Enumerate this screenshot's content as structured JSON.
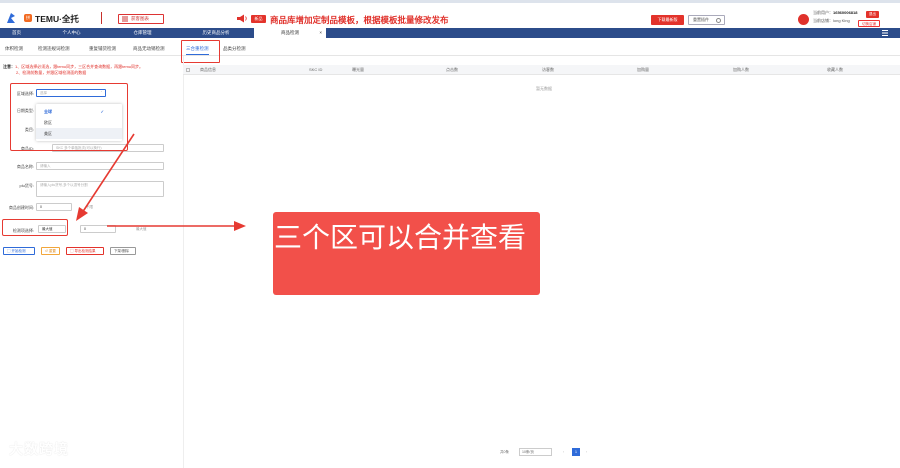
{
  "header": {
    "app_badge": "拼",
    "app_name": "TEMU·全托",
    "feature_btn": "获客图表",
    "new_tag": "新品",
    "announcement": "商品库增加定制品模板，根据模板批量修改发布",
    "install_btn": "下载最新版",
    "login_btn": "重置插件",
    "user_label": "当前用户：",
    "user_value": "16560006818",
    "store_label": "当前店铺：",
    "store_value": "long King",
    "logout_btn": "退出",
    "switch_btn": "切换店铺"
  },
  "page_tabs": [
    {
      "label": "首页"
    },
    {
      "label": "个人中心"
    },
    {
      "label": "仓库管理"
    },
    {
      "label": "历史商品分析"
    },
    {
      "label": "商品检测",
      "close": "×"
    }
  ],
  "sub_tabs": [
    "体积检测",
    "检测违规词检测",
    "重复铺货检测",
    "商品无动销检测",
    "三合重检测",
    "品类分检测"
  ],
  "notice": {
    "title": "注意：",
    "line1": "1、区域选择必须选，跟temu同步，三区合并查询数据，再跟temu同步。",
    "line2": "2、检测前数量，并跟区域检测面的数据"
  },
  "form": {
    "region_label": "区域选择:",
    "region_placeholder": "选择",
    "date_label": "日期类型:",
    "category_label": "类目:",
    "sku_label": "商品ID:",
    "sku_placeholder": "SKC    多个单独批次(可以换行)",
    "name_label": "商品名称:",
    "name_placeholder": "请输入",
    "plu_label": "plu货号:",
    "plu_placeholder": "请输入plu货号,多个以逗号分割",
    "time_label": "商品创建时间:",
    "time_start": "0",
    "time_end": "不限",
    "sort_label": "检测项选择:",
    "sort_value": "最大值",
    "sort_min": "0",
    "sort_max": "最大值"
  },
  "dropdown": {
    "items": [
      "全球",
      "欧区",
      "美区"
    ],
    "selected_mark": "✓"
  },
  "buttons": {
    "start": "开始检测",
    "reset": "重置",
    "export": "导出检测结果",
    "download": "下架/删除"
  },
  "table": {
    "headers": [
      "商品信息",
      "SKC ID",
      "曝光量",
      "点击数",
      "访客数",
      "加购量",
      "加购人数",
      "收藏人数"
    ],
    "empty": "暂无数据"
  },
  "pager": {
    "total": "共0条",
    "size": "10条/页",
    "page": "1"
  },
  "callout": "三个区可以合并查看",
  "watermark": "大数跨境",
  "colors": {
    "accent": "#e3332b",
    "nav": "#2c4c8a",
    "link": "#2f6bd9",
    "callout": "#f2504a"
  }
}
